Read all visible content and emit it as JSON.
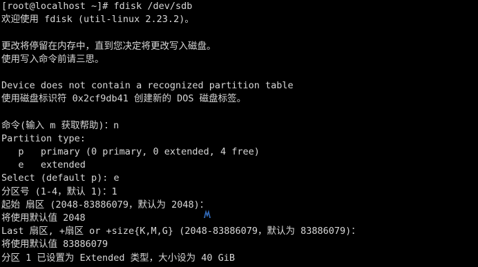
{
  "terminal": {
    "lines": [
      "[root@localhost ~]# fdisk /dev/sdb",
      "欢迎使用 fdisk (util-linux 2.23.2)。",
      "",
      "更改将停留在内存中，直到您决定将更改写入磁盘。",
      "使用写入命令前请三思。",
      "",
      "Device does not contain a recognized partition table",
      "使用磁盘标识符 0x2cf9db41 创建新的 DOS 磁盘标签。",
      "",
      "命令(输入 m 获取帮助)：n",
      "Partition type:",
      "   p   primary (0 primary, 0 extended, 4 free)",
      "   e   extended",
      "Select (default p): e",
      "分区号 (1-4，默认 1)：1",
      "起始 扇区 (2048-83886079，默认为 2048)：",
      "将使用默认值 2048",
      "Last 扇区, +扇区 or +size{K,M,G} (2048-83886079，默认为 83886079)：",
      "将使用默认值 83886079",
      "分区 1 已设置为 Extended 类型，大小设为 40 GiB"
    ]
  },
  "watermark": {
    "logo_icon": "brand-logo-icon",
    "color": "#3a7bd5"
  },
  "colors": {
    "background": "#000000",
    "foreground": "#d8d8d8"
  }
}
